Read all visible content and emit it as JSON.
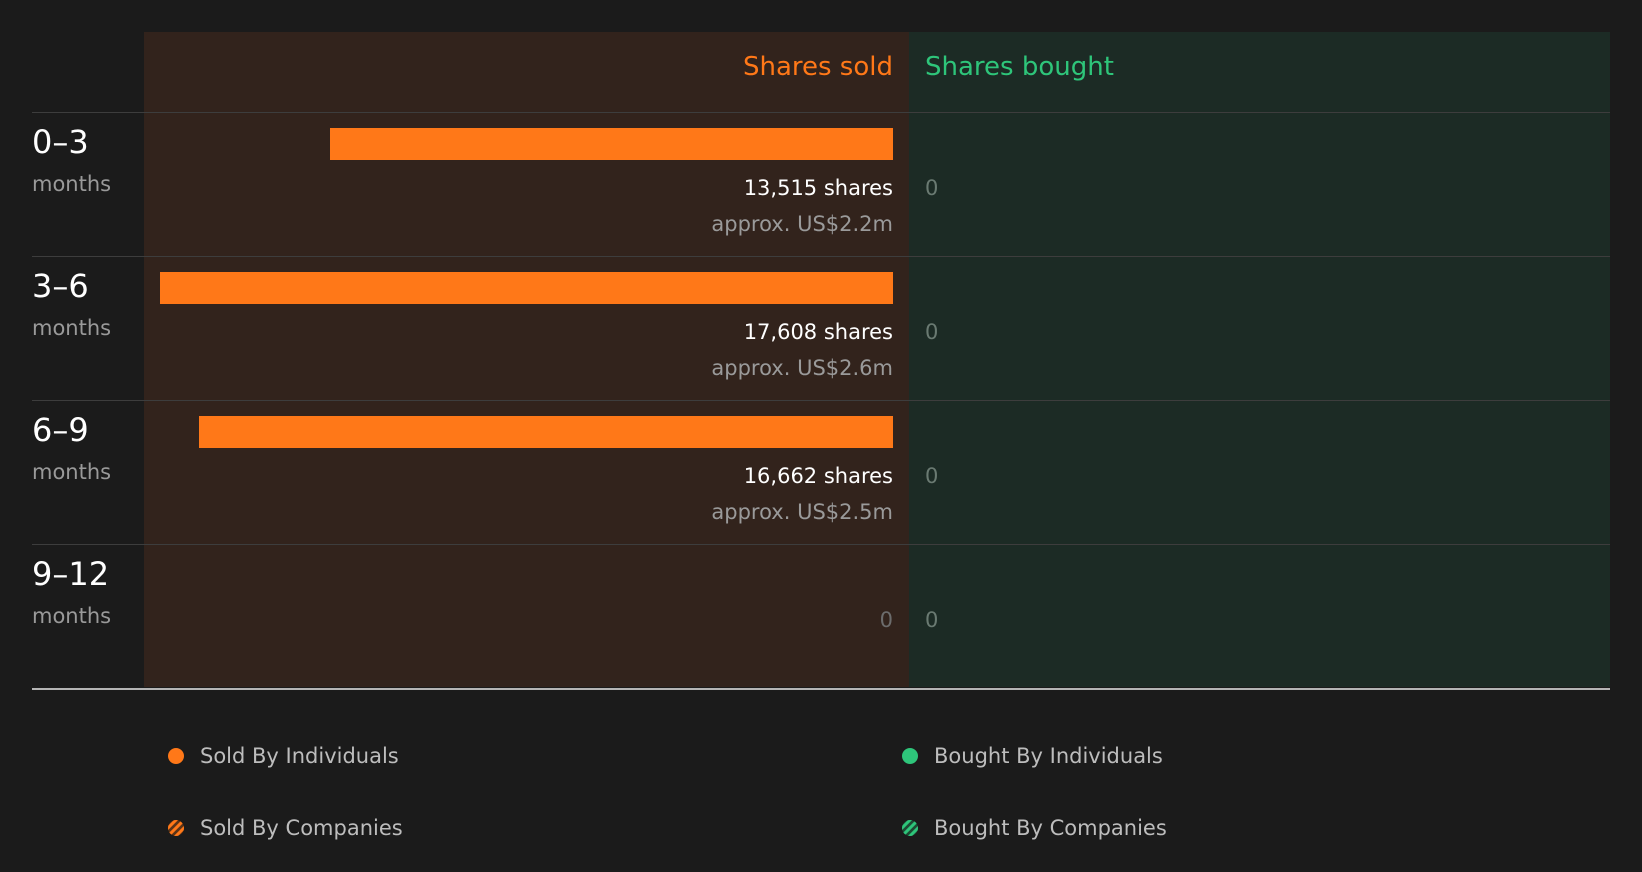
{
  "headers": {
    "sold": "Shares sold",
    "bought": "Shares bought"
  },
  "rows": [
    {
      "range": "0–3",
      "unit": "months",
      "sold_shares_label": "13,515 shares",
      "sold_value_label": "approx. US$2.2m",
      "sold_zero": "",
      "bought_label": "0"
    },
    {
      "range": "3–6",
      "unit": "months",
      "sold_shares_label": "17,608 shares",
      "sold_value_label": "approx. US$2.6m",
      "sold_zero": "",
      "bought_label": "0"
    },
    {
      "range": "6–9",
      "unit": "months",
      "sold_shares_label": "16,662 shares",
      "sold_value_label": "approx. US$2.5m",
      "sold_zero": "",
      "bought_label": "0"
    },
    {
      "range": "9–12",
      "unit": "months",
      "sold_shares_label": "",
      "sold_value_label": "",
      "sold_zero": "0",
      "bought_label": "0"
    }
  ],
  "legend": {
    "sold_individuals": "Sold By Individuals",
    "sold_companies": "Sold By Companies",
    "bought_individuals": "Bought By Individuals",
    "bought_companies": "Bought By Companies"
  },
  "colors": {
    "sold": "#ff7818",
    "bought": "#2ec57a",
    "sold_panel": "#32231c",
    "bought_panel": "#1c2b25",
    "background": "#1b1b1b"
  },
  "chart_data": {
    "type": "bar",
    "orientation": "horizontal",
    "categories": [
      "0–3 months",
      "3–6 months",
      "6–9 months",
      "9–12 months"
    ],
    "series": [
      {
        "name": "Shares sold",
        "values": [
          13515,
          17608,
          16662,
          0
        ],
        "value_usd_m": [
          2.2,
          2.6,
          2.5,
          0
        ]
      },
      {
        "name": "Shares bought",
        "values": [
          0,
          0,
          0,
          0
        ]
      }
    ],
    "legend": [
      "Sold By Individuals",
      "Sold By Companies",
      "Bought By Individuals",
      "Bought By Companies"
    ],
    "legend_position": "bottom"
  }
}
